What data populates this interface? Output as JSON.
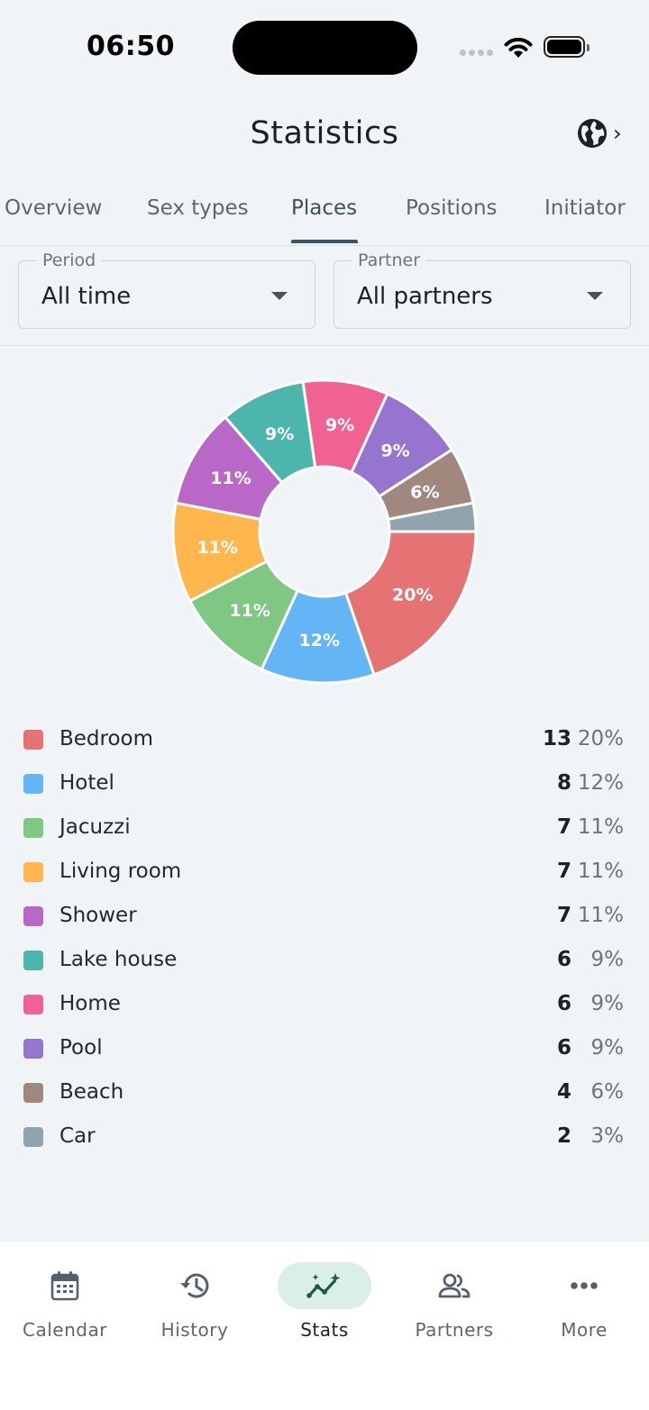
{
  "status": {
    "time": "06:50"
  },
  "header": {
    "title": "Statistics"
  },
  "tabs": [
    {
      "label": "Overview"
    },
    {
      "label": "Sex types"
    },
    {
      "label": "Places"
    },
    {
      "label": "Positions"
    },
    {
      "label": "Initiator"
    }
  ],
  "active_tab": "Places",
  "filters": {
    "period": {
      "label": "Period",
      "value": "All time"
    },
    "partner": {
      "label": "Partner",
      "value": "All partners"
    }
  },
  "chart_data": {
    "type": "pie",
    "donut": true,
    "categories": [
      "Bedroom",
      "Hotel",
      "Jacuzzi",
      "Living room",
      "Shower",
      "Lake house",
      "Home",
      "Pool",
      "Beach",
      "Car"
    ],
    "values": [
      13,
      8,
      7,
      7,
      7,
      6,
      6,
      6,
      4,
      2
    ],
    "slice_labels": [
      "20%",
      "12%",
      "11%",
      "11%",
      "11%",
      "9%",
      "9%",
      "9%",
      "6%",
      ""
    ],
    "colors": [
      "#e57373",
      "#64b5f6",
      "#81c784",
      "#ffb74d",
      "#ba68c8",
      "#4db6ac",
      "#f06292",
      "#9575cd",
      "#a1887f",
      "#90a4ae"
    ]
  },
  "legend": [
    {
      "name": "Bedroom",
      "count": "13",
      "pct": "20%"
    },
    {
      "name": "Hotel",
      "count": "8",
      "pct": "12%"
    },
    {
      "name": "Jacuzzi",
      "count": "7",
      "pct": "11%"
    },
    {
      "name": "Living room",
      "count": "7",
      "pct": "11%"
    },
    {
      "name": "Shower",
      "count": "7",
      "pct": "11%"
    },
    {
      "name": "Lake house",
      "count": "6",
      "pct": "9%"
    },
    {
      "name": "Home",
      "count": "6",
      "pct": "9%"
    },
    {
      "name": "Pool",
      "count": "6",
      "pct": "9%"
    },
    {
      "name": "Beach",
      "count": "4",
      "pct": "6%"
    },
    {
      "name": "Car",
      "count": "2",
      "pct": "3%"
    }
  ],
  "nav": [
    {
      "label": "Calendar",
      "icon": "calendar-icon"
    },
    {
      "label": "History",
      "icon": "history-icon"
    },
    {
      "label": "Stats",
      "icon": "stats-icon"
    },
    {
      "label": "Partners",
      "icon": "partners-icon"
    },
    {
      "label": "More",
      "icon": "more-icon"
    }
  ],
  "active_nav": "Stats"
}
